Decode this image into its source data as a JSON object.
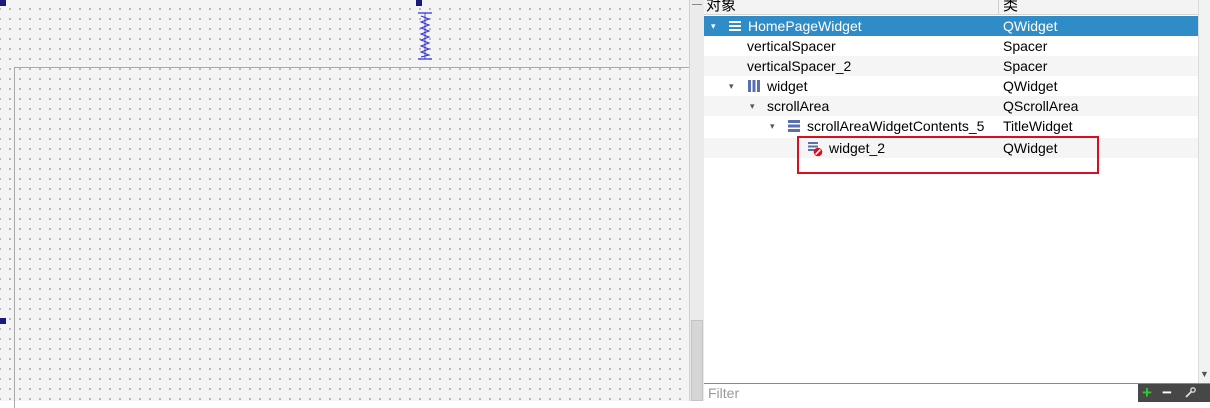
{
  "inspector": {
    "headers": {
      "object": "对象",
      "class": "类"
    },
    "rows": [
      {
        "name": "HomePageWidget",
        "class": "QWidget",
        "selected": true,
        "arrow": "▾",
        "icon": "layout-vertical-icon"
      },
      {
        "name": "verticalSpacer",
        "class": "Spacer"
      },
      {
        "name": "verticalSpacer_2",
        "class": "Spacer"
      },
      {
        "name": "widget",
        "class": "QWidget",
        "arrow": "▾",
        "icon": "layout-columns-icon"
      },
      {
        "name": "scrollArea",
        "class": "QScrollArea",
        "arrow": "▾"
      },
      {
        "name": "scrollAreaWidgetContents_5",
        "class": "TitleWidget",
        "arrow": "▾",
        "icon": "layout-rows-icon"
      },
      {
        "name": "widget_2",
        "class": "QWidget",
        "icon": "broken-layout-icon"
      }
    ],
    "filter": {
      "placeholder": "Filter",
      "value": ""
    },
    "tools": {
      "add_label": "+",
      "remove_label": "−"
    }
  },
  "colors": {
    "selection": "#308cc6",
    "highlight_box": "#d6101e",
    "add_tool": "#2ecc2e"
  }
}
